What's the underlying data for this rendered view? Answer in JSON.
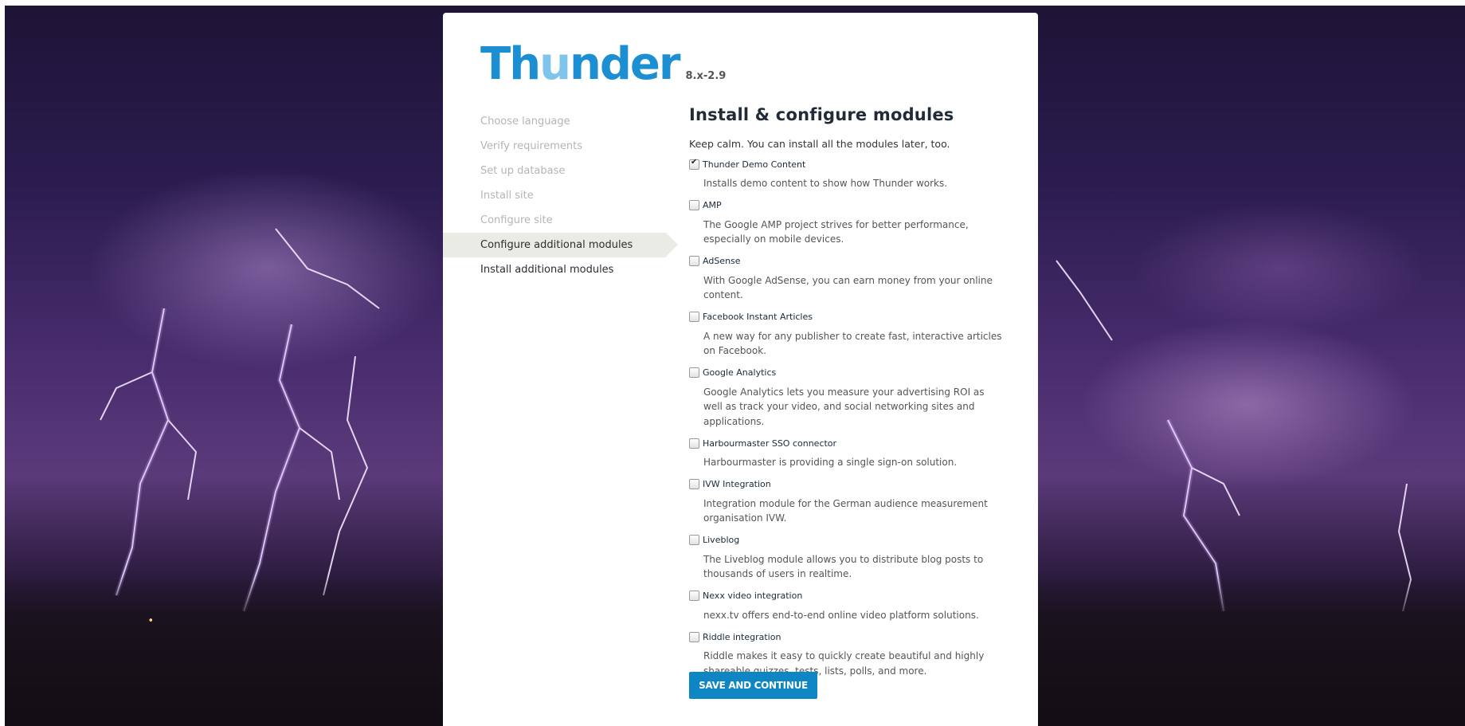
{
  "branding": {
    "logo_prefix": "Th",
    "logo_u": "u",
    "logo_suffix": "nder",
    "version": "8.x-2.9",
    "brand_color": "#1b8fd2"
  },
  "steps": [
    {
      "label": "Choose language",
      "state": "done"
    },
    {
      "label": "Verify requirements",
      "state": "done"
    },
    {
      "label": "Set up database",
      "state": "done"
    },
    {
      "label": "Install site",
      "state": "done"
    },
    {
      "label": "Configure site",
      "state": "done"
    },
    {
      "label": "Configure additional modules",
      "state": "active"
    },
    {
      "label": "Install additional modules",
      "state": "todo"
    }
  ],
  "main": {
    "title": "Install & configure modules",
    "lead": "Keep calm. You can install all the modules later, too.",
    "modules": [
      {
        "label": "Thunder Demo Content",
        "checked": true,
        "desc": "Installs demo content to show how Thunder works."
      },
      {
        "label": "AMP",
        "checked": false,
        "desc": "The Google AMP project strives for better performance, especially on mobile devices."
      },
      {
        "label": "AdSense",
        "checked": false,
        "desc": "With Google AdSense, you can earn money from your online content."
      },
      {
        "label": "Facebook Instant Articles",
        "checked": false,
        "desc": "A new way for any publisher to create fast, interactive articles on Facebook."
      },
      {
        "label": "Google Analytics",
        "checked": false,
        "desc": "Google Analytics lets you measure your advertising ROI as well as track your video, and social networking sites and applications."
      },
      {
        "label": "Harbourmaster SSO connector",
        "checked": false,
        "desc": "Harbourmaster is providing a single sign-on solution."
      },
      {
        "label": "IVW Integration",
        "checked": false,
        "desc": "Integration module for the German audience measurement organisation IVW."
      },
      {
        "label": "Liveblog",
        "checked": false,
        "desc": "The Liveblog module allows you to distribute blog posts to thousands of users in realtime."
      },
      {
        "label": "Nexx video integration",
        "checked": false,
        "desc": "nexx.tv offers end-to-end online video platform solutions."
      },
      {
        "label": "Riddle integration",
        "checked": false,
        "desc": "Riddle makes it easy to quickly create beautiful and highly shareable quizzes, tests, lists, polls, and more."
      }
    ],
    "submit_label": "SAVE AND CONTINUE",
    "button_color": "#0e86c4"
  }
}
